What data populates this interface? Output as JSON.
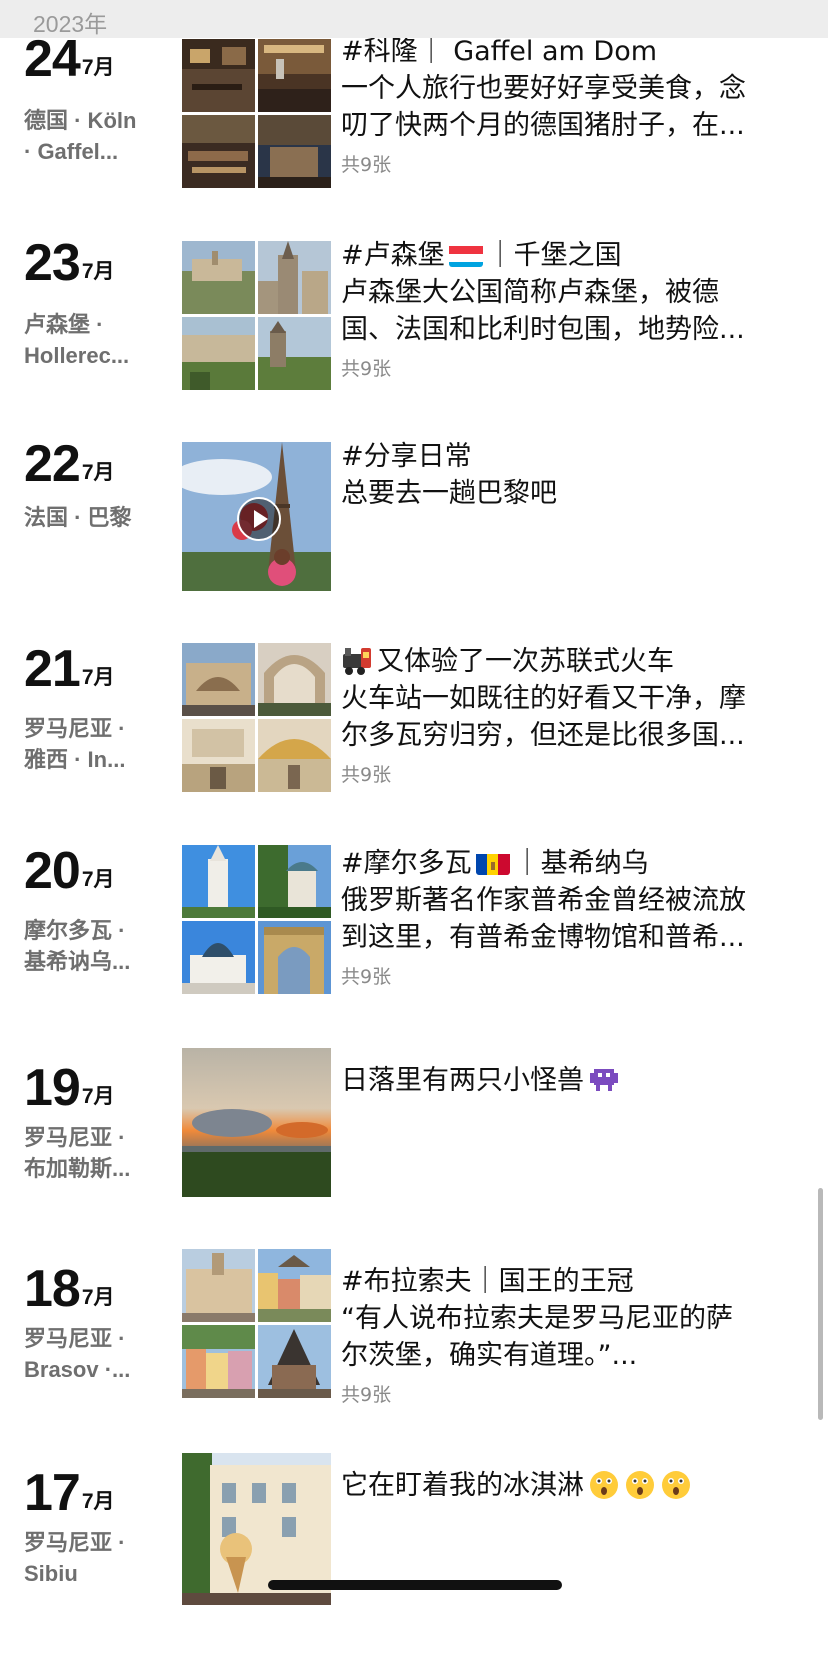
{
  "header": {
    "year": "2023年"
  },
  "posts": [
    {
      "day": "24",
      "month": "7月",
      "location": "德国 · Köln\n· Gaffel...",
      "title": "#科隆｜ Gaffel am Dom",
      "lines": [
        "一个人旅行也要好好享受美食，念",
        "叨了快两个月的德国猪肘子，在..."
      ],
      "count": "共9张"
    },
    {
      "day": "23",
      "month": "7月",
      "location": "卢森堡 ·\nHollerec...",
      "title_a": "#卢森堡",
      "title_b": "｜千堡之国",
      "lines": [
        "卢森堡大公国简称卢森堡，被德",
        "国、法国和比利时包围，地势险..."
      ],
      "count": "共9张"
    },
    {
      "day": "22",
      "month": "7月",
      "location": "法国 · 巴黎",
      "title": "#分享日常",
      "lines": [
        "总要去一趟巴黎吧"
      ]
    },
    {
      "day": "21",
      "month": "7月",
      "location": "罗马尼亚 ·\n雅西 · In...",
      "title": "又体验了一次苏联式火车",
      "lines": [
        "火车站一如既往的好看又干净，摩",
        "尔多瓦穷归穷，但还是比很多国..."
      ],
      "count": "共9张"
    },
    {
      "day": "20",
      "month": "7月",
      "location": "摩尔多瓦 ·\n基希讷乌...",
      "title_a": "#摩尔多瓦",
      "title_b": "｜基希纳乌",
      "lines": [
        "俄罗斯著名作家普希金曾经被流放",
        "到这里，有普希金博物馆和普希..."
      ],
      "count": "共9张"
    },
    {
      "day": "19",
      "month": "7月",
      "location": "罗马尼亚 ·\n布加勒斯...",
      "title": "日落里有两只小怪兽"
    },
    {
      "day": "18",
      "month": "7月",
      "location": "罗马尼亚 ·\nBrasov ·...",
      "title": "#布拉索夫｜国王的王冠",
      "lines": [
        "“有人说布拉索夫是罗马尼亚的萨",
        "尔茨堡，确实有道理。”..."
      ],
      "count": "共9张"
    },
    {
      "day": "17",
      "month": "7月",
      "location": "罗马尼亚 ·\nSibiu",
      "title": "它在盯着我的冰淇淋"
    }
  ],
  "icons": {
    "play": "play-icon",
    "train": "train-icon",
    "alien": "alien-monster-icon",
    "astonished": "astonished-face-icon",
    "flag_lu": "luxembourg-flag-icon",
    "flag_md": "moldova-flag-icon"
  }
}
